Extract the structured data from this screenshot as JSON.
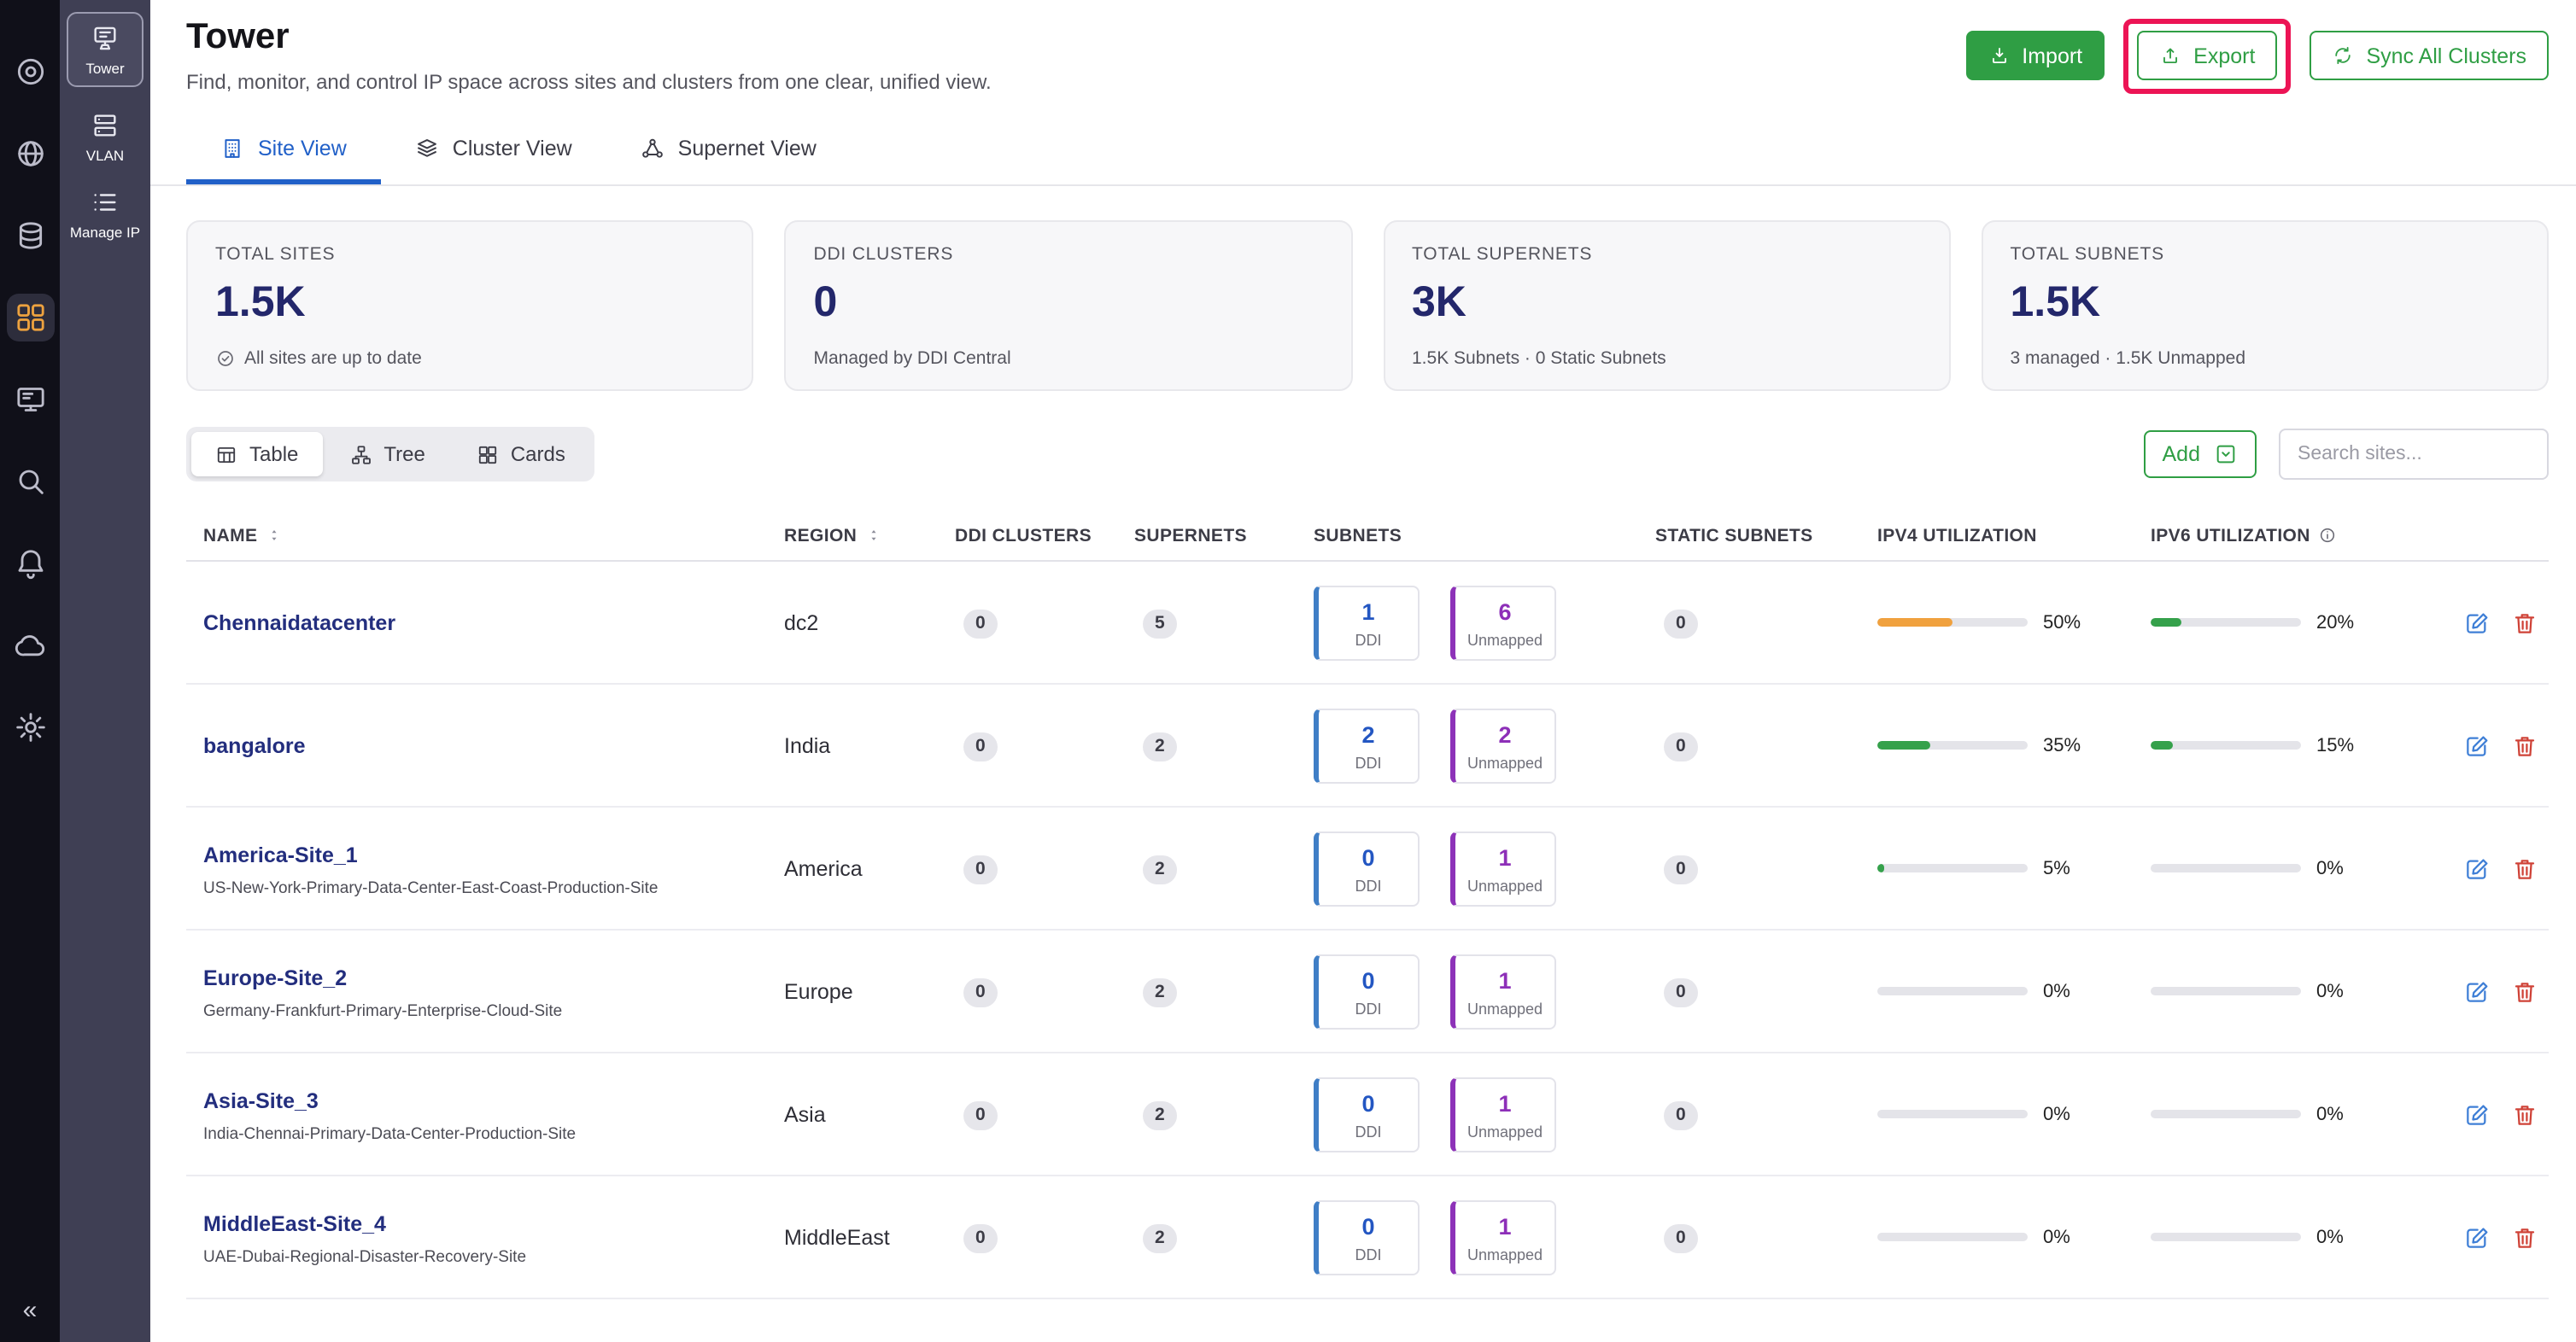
{
  "sidebar": {
    "rail_icons": [
      "dashboard-icon",
      "globe-icon",
      "database-icon",
      "apps-icon",
      "monitor-icon",
      "search-icon",
      "bell-icon",
      "cloud-icon",
      "settings-icon"
    ],
    "active_rail_index": 3,
    "collapse": "«",
    "nav_items": [
      {
        "label": "Tower",
        "active": true
      },
      {
        "label": "VLAN",
        "active": false
      },
      {
        "label": "Manage IP",
        "active": false
      }
    ]
  },
  "header": {
    "title": "Tower",
    "subtitle": "Find, monitor, and control IP space across sites and clusters from one clear, unified view.",
    "import_label": "Import",
    "export_label": "Export",
    "sync_label": "Sync All Clusters"
  },
  "tabs": [
    {
      "label": "Site View",
      "active": true
    },
    {
      "label": "Cluster View",
      "active": false
    },
    {
      "label": "Supernet View",
      "active": false
    }
  ],
  "stats": [
    {
      "label": "TOTAL SITES",
      "value": "1.5K",
      "note": "All sites are up to date"
    },
    {
      "label": "DDI CLUSTERS",
      "value": "0",
      "note": "Managed by DDI Central"
    },
    {
      "label": "TOTAL SUPERNETS",
      "value": "3K",
      "note": "1.5K Subnets · 0 Static Subnets"
    },
    {
      "label": "TOTAL SUBNETS",
      "value": "1.5K",
      "note": "3 managed · 1.5K Unmapped"
    }
  ],
  "toolbar": {
    "views": [
      {
        "label": "Table",
        "active": true
      },
      {
        "label": "Tree",
        "active": false
      },
      {
        "label": "Cards",
        "active": false
      }
    ],
    "add_label": "Add",
    "search_placeholder": "Search sites..."
  },
  "table": {
    "columns": [
      {
        "label": "NAME",
        "sortable": true
      },
      {
        "label": "REGION",
        "sortable": true
      },
      {
        "label": "DDI CLUSTERS"
      },
      {
        "label": "SUPERNETS"
      },
      {
        "label": "SUBNETS"
      },
      {
        "label": "STATIC SUBNETS"
      },
      {
        "label": "IPV4 UTILIZATION"
      },
      {
        "label": "IPV6 UTILIZATION",
        "info": true
      }
    ],
    "labels": {
      "ddi": "DDI",
      "unmapped": "Unmapped"
    },
    "rows": [
      {
        "name": "Chennaidatacenter",
        "subtitle": "",
        "region": "dc2",
        "ddi_clusters": "0",
        "supernets": "5",
        "ddi": "1",
        "unmapped": "6",
        "static_subnets": "0",
        "ipv4_pct": 50,
        "ipv4_label": "50%",
        "ipv4_color": "#f0a13e",
        "ipv6_pct": 20,
        "ipv6_label": "20%",
        "ipv6_color": "#35a14b"
      },
      {
        "name": "bangalore",
        "subtitle": "",
        "region": "India",
        "ddi_clusters": "0",
        "supernets": "2",
        "ddi": "2",
        "unmapped": "2",
        "static_subnets": "0",
        "ipv4_pct": 35,
        "ipv4_label": "35%",
        "ipv4_color": "#35a14b",
        "ipv6_pct": 15,
        "ipv6_label": "15%",
        "ipv6_color": "#35a14b"
      },
      {
        "name": "America-Site_1",
        "subtitle": "US-New-York-Primary-Data-Center-East-Coast-Production-Site",
        "region": "America",
        "ddi_clusters": "0",
        "supernets": "2",
        "ddi": "0",
        "unmapped": "1",
        "static_subnets": "0",
        "ipv4_pct": 5,
        "ipv4_label": "5%",
        "ipv4_color": "#35a14b",
        "ipv6_pct": 0,
        "ipv6_label": "0%",
        "ipv6_color": "#35a14b"
      },
      {
        "name": "Europe-Site_2",
        "subtitle": "Germany-Frankfurt-Primary-Enterprise-Cloud-Site",
        "region": "Europe",
        "ddi_clusters": "0",
        "supernets": "2",
        "ddi": "0",
        "unmapped": "1",
        "static_subnets": "0",
        "ipv4_pct": 0,
        "ipv4_label": "0%",
        "ipv4_color": "#35a14b",
        "ipv6_pct": 0,
        "ipv6_label": "0%",
        "ipv6_color": "#35a14b"
      },
      {
        "name": "Asia-Site_3",
        "subtitle": "India-Chennai-Primary-Data-Center-Production-Site",
        "region": "Asia",
        "ddi_clusters": "0",
        "supernets": "2",
        "ddi": "0",
        "unmapped": "1",
        "static_subnets": "0",
        "ipv4_pct": 0,
        "ipv4_label": "0%",
        "ipv4_color": "#35a14b",
        "ipv6_pct": 0,
        "ipv6_label": "0%",
        "ipv6_color": "#35a14b"
      },
      {
        "name": "MiddleEast-Site_4",
        "subtitle": "UAE-Dubai-Regional-Disaster-Recovery-Site",
        "region": "MiddleEast",
        "ddi_clusters": "0",
        "supernets": "2",
        "ddi": "0",
        "unmapped": "1",
        "static_subnets": "0",
        "ipv4_pct": 0,
        "ipv4_label": "0%",
        "ipv4_color": "#35a14b",
        "ipv6_pct": 0,
        "ipv6_label": "0%",
        "ipv6_color": "#35a14b"
      }
    ]
  },
  "annotation": {
    "color": "#ec1455"
  }
}
